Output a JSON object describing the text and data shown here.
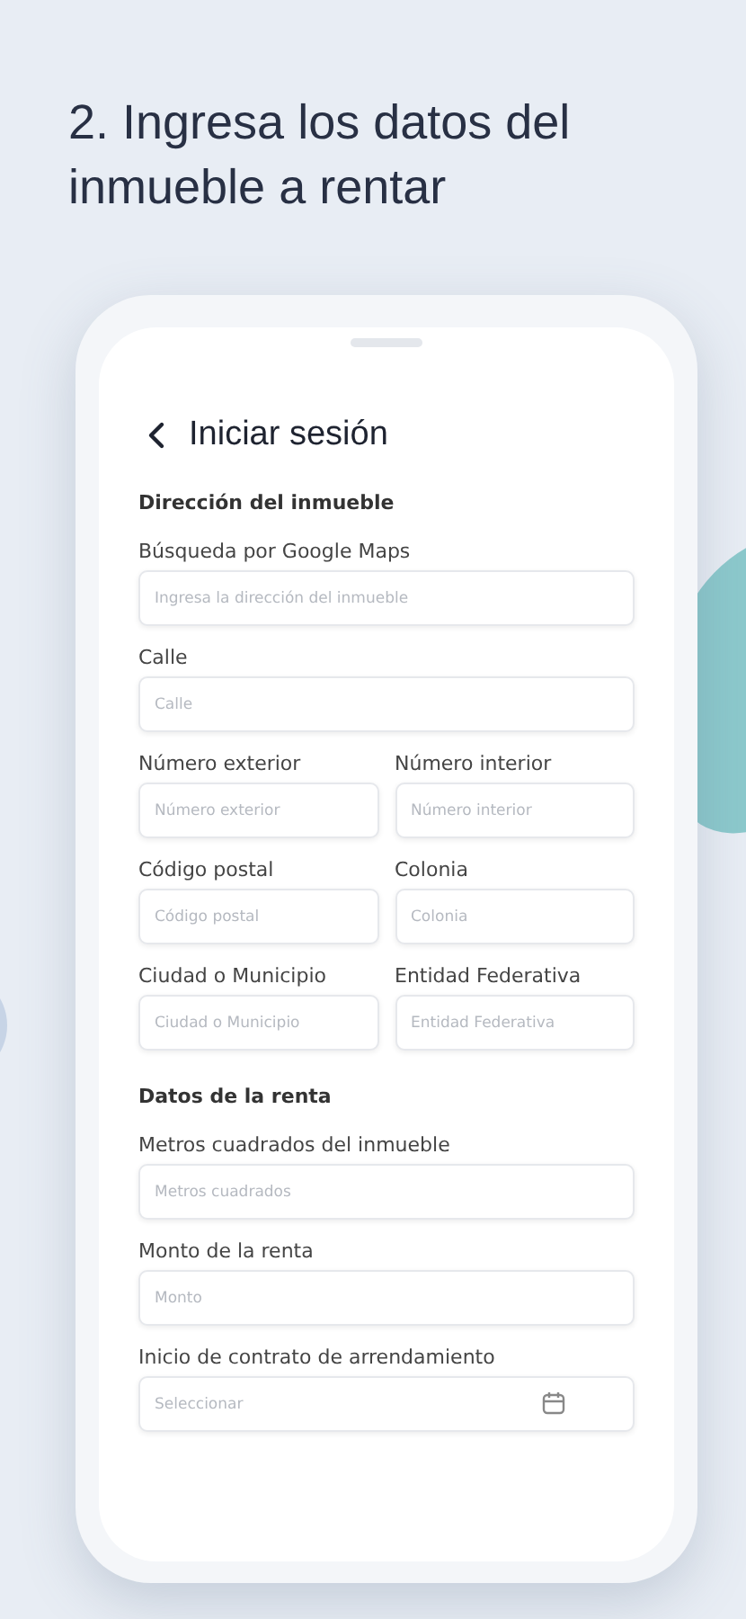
{
  "headline": "2. Ingresa los datos del inmueble a rentar",
  "screen": {
    "title": "Iniciar sesión",
    "sections": [
      {
        "title": "Dirección del inmueble",
        "rows": [
          [
            {
              "label": "Búsqueda por Google Maps",
              "placeholder": "Ingresa la dirección del inmueble",
              "kind": "text"
            }
          ],
          [
            {
              "label": "Calle",
              "placeholder": "Calle",
              "kind": "text"
            }
          ],
          [
            {
              "label": "Número exterior",
              "placeholder": "Número exterior",
              "kind": "text"
            },
            {
              "label": "Número interior",
              "placeholder": "Número interior",
              "kind": "text"
            }
          ],
          [
            {
              "label": "Código postal",
              "placeholder": "Código postal",
              "kind": "text"
            },
            {
              "label": "Colonia",
              "placeholder": "Colonia",
              "kind": "text"
            }
          ],
          [
            {
              "label": "Ciudad o Municipio",
              "placeholder": "Ciudad o Municipio",
              "kind": "text"
            },
            {
              "label": "Entidad Federativa",
              "placeholder": "Entidad Federativa",
              "kind": "text"
            }
          ]
        ]
      },
      {
        "title": "Datos de la renta",
        "rows": [
          [
            {
              "label": "Metros cuadrados del inmueble",
              "placeholder": "Metros cuadrados",
              "kind": "text"
            }
          ],
          [
            {
              "label": "Monto de la renta",
              "placeholder": "Monto",
              "kind": "text"
            }
          ],
          [
            {
              "label": "Inicio de contrato de arrendamiento",
              "placeholder": "Seleccionar",
              "kind": "date"
            }
          ]
        ]
      }
    ]
  }
}
